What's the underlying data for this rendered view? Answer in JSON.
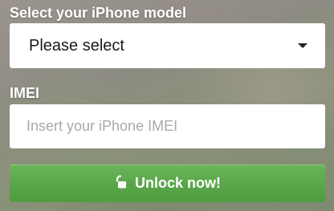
{
  "form": {
    "model_label": "Select your iPhone model",
    "model_select": {
      "selected": "Please select",
      "icon": "chevron-down-icon"
    },
    "imei_label": "IMEI",
    "imei_input": {
      "value": "",
      "placeholder": "Insert your iPhone IMEI"
    },
    "unlock_button": {
      "label": "Unlock now!",
      "icon": "unlock-icon",
      "color": "#5aa84b"
    }
  }
}
